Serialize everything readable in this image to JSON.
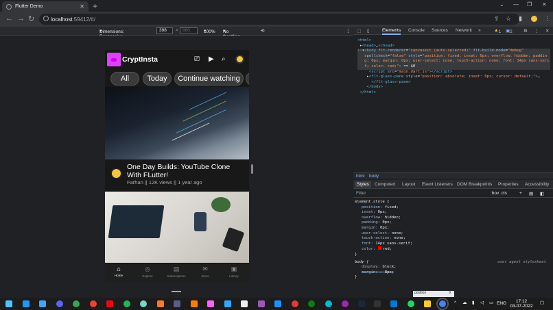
{
  "browser": {
    "tab_title": "Flutter Demo",
    "url_host": "localhost",
    "url_rest": ":59412/#/"
  },
  "devicebar": {
    "dimensions_label": "Dimensions: Responsive",
    "width": "398",
    "height_placeholder": "860",
    "zoom": "100%",
    "throttle": "No throttling"
  },
  "app": {
    "brand": "CryptInsta",
    "chips": [
      "All",
      "Today",
      "Continue watching"
    ],
    "video": {
      "title": "One Day Builds: YouTube Clone With FLutter!",
      "meta": "Farhan || 12K views || 1 year ago"
    },
    "bottom_nav": [
      {
        "label": "Home",
        "icon": "home-icon"
      },
      {
        "label": "Explore",
        "icon": "explore-icon"
      },
      {
        "label": "Subscriptions",
        "icon": "subscriptions-icon"
      },
      {
        "label": "Inbox",
        "icon": "inbox-icon"
      },
      {
        "label": "Library",
        "icon": "library-icon"
      }
    ]
  },
  "devtools": {
    "tabs": [
      "Elements",
      "Console",
      "Sources",
      "Network"
    ],
    "badges": {
      "warnings": "1",
      "messages": "2"
    },
    "crumbs": [
      "html",
      "body"
    ],
    "style_tabs": [
      "Styles",
      "Computed",
      "Layout",
      "Event Listeners",
      "DOM Breakpoints",
      "Properties",
      "Accessibility"
    ],
    "filter_placeholder": "Filter",
    "filter_tools": ":hov  .cls",
    "element_style": [
      [
        "position",
        "fixed"
      ],
      [
        "inset",
        "0px"
      ],
      [
        "overflow",
        "hidden"
      ],
      [
        "padding",
        "0px"
      ],
      [
        "margin",
        "0px"
      ],
      [
        "user-select",
        "none"
      ],
      [
        "touch-action",
        "none"
      ],
      [
        "font",
        "14px sans-serif"
      ],
      [
        "color",
        "red"
      ]
    ],
    "ua_label": "user agent stylesheet",
    "box_label": "position",
    "box_value": "0"
  },
  "taskbar": {
    "lang": "ENG",
    "time": "17:12",
    "date": "03-07-2022"
  }
}
